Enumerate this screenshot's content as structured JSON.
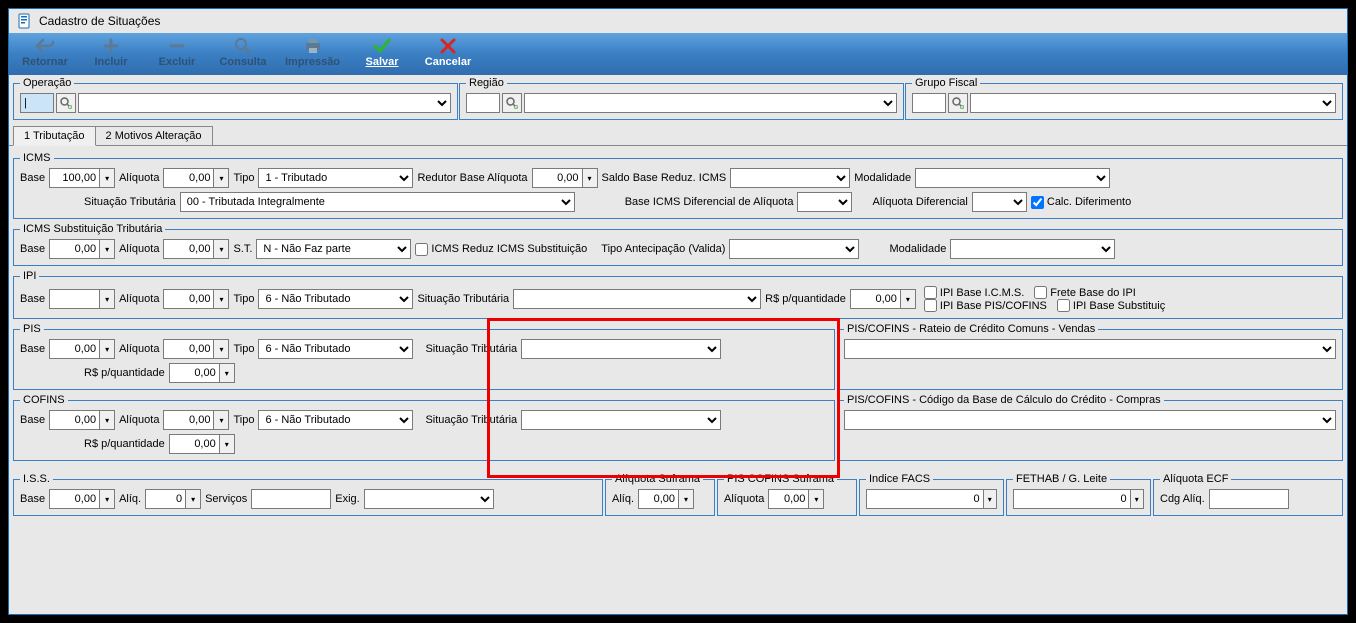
{
  "window": {
    "title": "Cadastro de Situações"
  },
  "toolbar": {
    "retornar": "Retornar",
    "incluir": "Incluir",
    "excluir": "Excluir",
    "consulta": "Consulta",
    "impressao": "Impressão",
    "salvar": "Salvar",
    "cancelar": "Cancelar"
  },
  "top": {
    "operacao": {
      "legend": "Operação",
      "value": "|"
    },
    "regiao": {
      "legend": "Região"
    },
    "grupo_fiscal": {
      "legend": "Grupo Fiscal"
    }
  },
  "tabs": {
    "t1": "1 Tributação",
    "t2": "2 Motivos Alteração"
  },
  "icms": {
    "legend": "ICMS",
    "base_lbl": "Base",
    "base_val": "100,00",
    "aliq_lbl": "Alíquota",
    "aliq_val": "0,00",
    "tipo_lbl": "Tipo",
    "tipo_val": "1 - Tributado",
    "redutor_lbl": "Redutor Base Alíquota",
    "redutor_val": "0,00",
    "saldo_lbl": "Saldo Base Reduz. ICMS",
    "modalidade_lbl": "Modalidade",
    "sit_trib_lbl": "Situação Tributária",
    "sit_trib_val": "00 - Tributada Integralmente",
    "base_dif_lbl": "Base ICMS Diferencial de Alíquota",
    "aliq_dif_lbl": "Alíquota Diferencial",
    "calc_dif_lbl": "Calc. Diferimento"
  },
  "icms_st": {
    "legend": "ICMS Substituição Tributária",
    "base_lbl": "Base",
    "base_val": "0,00",
    "aliq_lbl": "Alíquota",
    "aliq_val": "0,00",
    "st_lbl": "S.T.",
    "st_val": "N - Não Faz parte",
    "reduz_lbl": "ICMS Reduz ICMS Substituição",
    "tipo_antec_lbl": "Tipo Antecipação (Valida)",
    "modalidade_lbl": "Modalidade"
  },
  "ipi": {
    "legend": "IPI",
    "base_lbl": "Base",
    "aliq_lbl": "Alíquota",
    "aliq_val": "0,00",
    "tipo_lbl": "Tipo",
    "tipo_val": "6 - Não Tributado",
    "sit_trib_lbl": "Situação Tributária",
    "rs_qtd_lbl": "R$ p/quantidade",
    "rs_qtd_val": "0,00",
    "cb1": "IPI Base I.C.M.S.",
    "cb2": "Frete Base do IPI",
    "cb3": "IPI Base PIS/COFINS",
    "cb4": "IPI Base Substituiç"
  },
  "pis": {
    "legend": "PIS",
    "base_lbl": "Base",
    "base_val": "0,00",
    "aliq_lbl": "Alíquota",
    "aliq_val": "0,00",
    "tipo_lbl": "Tipo",
    "tipo_val": "6 - Não Tributado",
    "sit_trib_lbl": "Situação Tributária",
    "rs_qtd_lbl": "R$ p/quantidade",
    "rs_qtd_val": "0,00"
  },
  "cofins": {
    "legend": "COFINS",
    "base_lbl": "Base",
    "base_val": "0,00",
    "aliq_lbl": "Alíquota",
    "aliq_val": "0,00",
    "tipo_lbl": "Tipo",
    "tipo_val": "6 - Não Tributado",
    "sit_trib_lbl": "Situação Tributária",
    "rs_qtd_lbl": "R$ p/quantidade",
    "rs_qtd_val": "0,00"
  },
  "pis_cofins_rateio": {
    "legend": "PIS/COFINS - Rateio de Crédito Comuns - Vendas"
  },
  "pis_cofins_codigo": {
    "legend": "PIS/COFINS - Código da Base de Cálculo do Crédito - Compras"
  },
  "iss": {
    "legend": "I.S.S.",
    "base_lbl": "Base",
    "base_val": "0,00",
    "aliq_lbl": "Alíq.",
    "aliq_val": "0",
    "serv_lbl": "Serviços",
    "exig_lbl": "Exig."
  },
  "aliq_suframa": {
    "legend": "Alíquota Suframa",
    "aliq_lbl": "Alíq.",
    "aliq_val": "0,00"
  },
  "pis_cofins_suframa": {
    "legend": "PIS COFINS Suframa",
    "aliq_lbl": "Alíquota",
    "aliq_val": "0,00"
  },
  "indice_facs": {
    "legend": "Indice FACS",
    "val": "0"
  },
  "fethab": {
    "legend": "FETHAB / G. Leite",
    "val": "0"
  },
  "aliq_ecf": {
    "legend": "Alíquota ECF",
    "cdg_lbl": "Cdg Alíq."
  }
}
